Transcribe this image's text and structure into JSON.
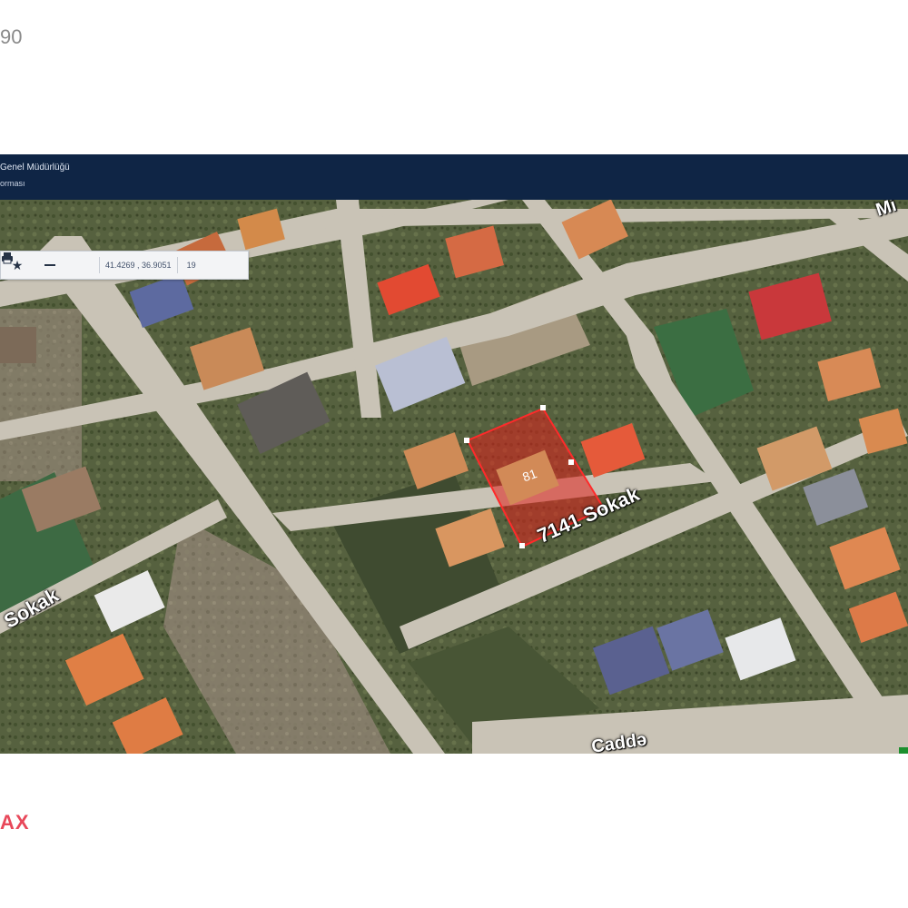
{
  "page": {
    "top_number": "90",
    "bottom_logo": "AX"
  },
  "header": {
    "org": "Genel Müdürlüğü",
    "subtitle": "orması"
  },
  "toolbar": {
    "coordinates": "41.4269 , 36.9051",
    "zoom": "19",
    "icons": [
      "star-icon",
      "minus-icon",
      "print-icon"
    ]
  },
  "map": {
    "type": "satellite",
    "parcel_label": "81",
    "parcel_color": "#e0201c",
    "streets": [
      "7141 Sokak",
      "Sokak",
      "Caddə",
      "Mi"
    ]
  }
}
